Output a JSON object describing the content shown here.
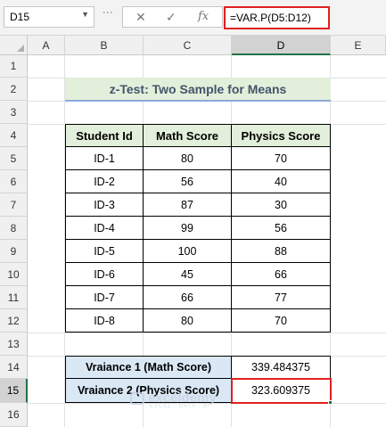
{
  "formula_bar": {
    "name_box": "D15",
    "cancel_icon": "✕",
    "confirm_icon": "✓",
    "fx_label": "fx",
    "formula": "=VAR.P(D5:D12)"
  },
  "columns": [
    "A",
    "B",
    "C",
    "D",
    "E"
  ],
  "rows": [
    "1",
    "2",
    "3",
    "4",
    "5",
    "6",
    "7",
    "8",
    "9",
    "10",
    "11",
    "12",
    "13",
    "14",
    "15",
    "16"
  ],
  "selected_cell": {
    "column": "D",
    "row": "15"
  },
  "title": "z-Test: Two Sample for Means",
  "table": {
    "headers": [
      "Student Id",
      "Math  Score",
      "Physics  Score"
    ],
    "rows": [
      [
        "ID-1",
        "80",
        "70"
      ],
      [
        "ID-2",
        "56",
        "40"
      ],
      [
        "ID-3",
        "87",
        "30"
      ],
      [
        "ID-4",
        "99",
        "56"
      ],
      [
        "ID-5",
        "100",
        "88"
      ],
      [
        "ID-6",
        "45",
        "66"
      ],
      [
        "ID-7",
        "66",
        "77"
      ],
      [
        "ID-8",
        "80",
        "70"
      ]
    ]
  },
  "variance": {
    "math_label": "Vraiance 1 (Math Score)",
    "math_value": "339.484375",
    "physics_label": "Vraiance 2 (Physics Score)",
    "physics_value": "323.609375"
  },
  "watermark": {
    "name": "exceldemy",
    "tagline": "EXCEL · DATA · BI"
  },
  "colors": {
    "header_green": "#e2efda",
    "label_blue": "#dae7f5",
    "highlight_red": "#e02020",
    "excel_green": "#217346",
    "title_text": "#44546a"
  }
}
